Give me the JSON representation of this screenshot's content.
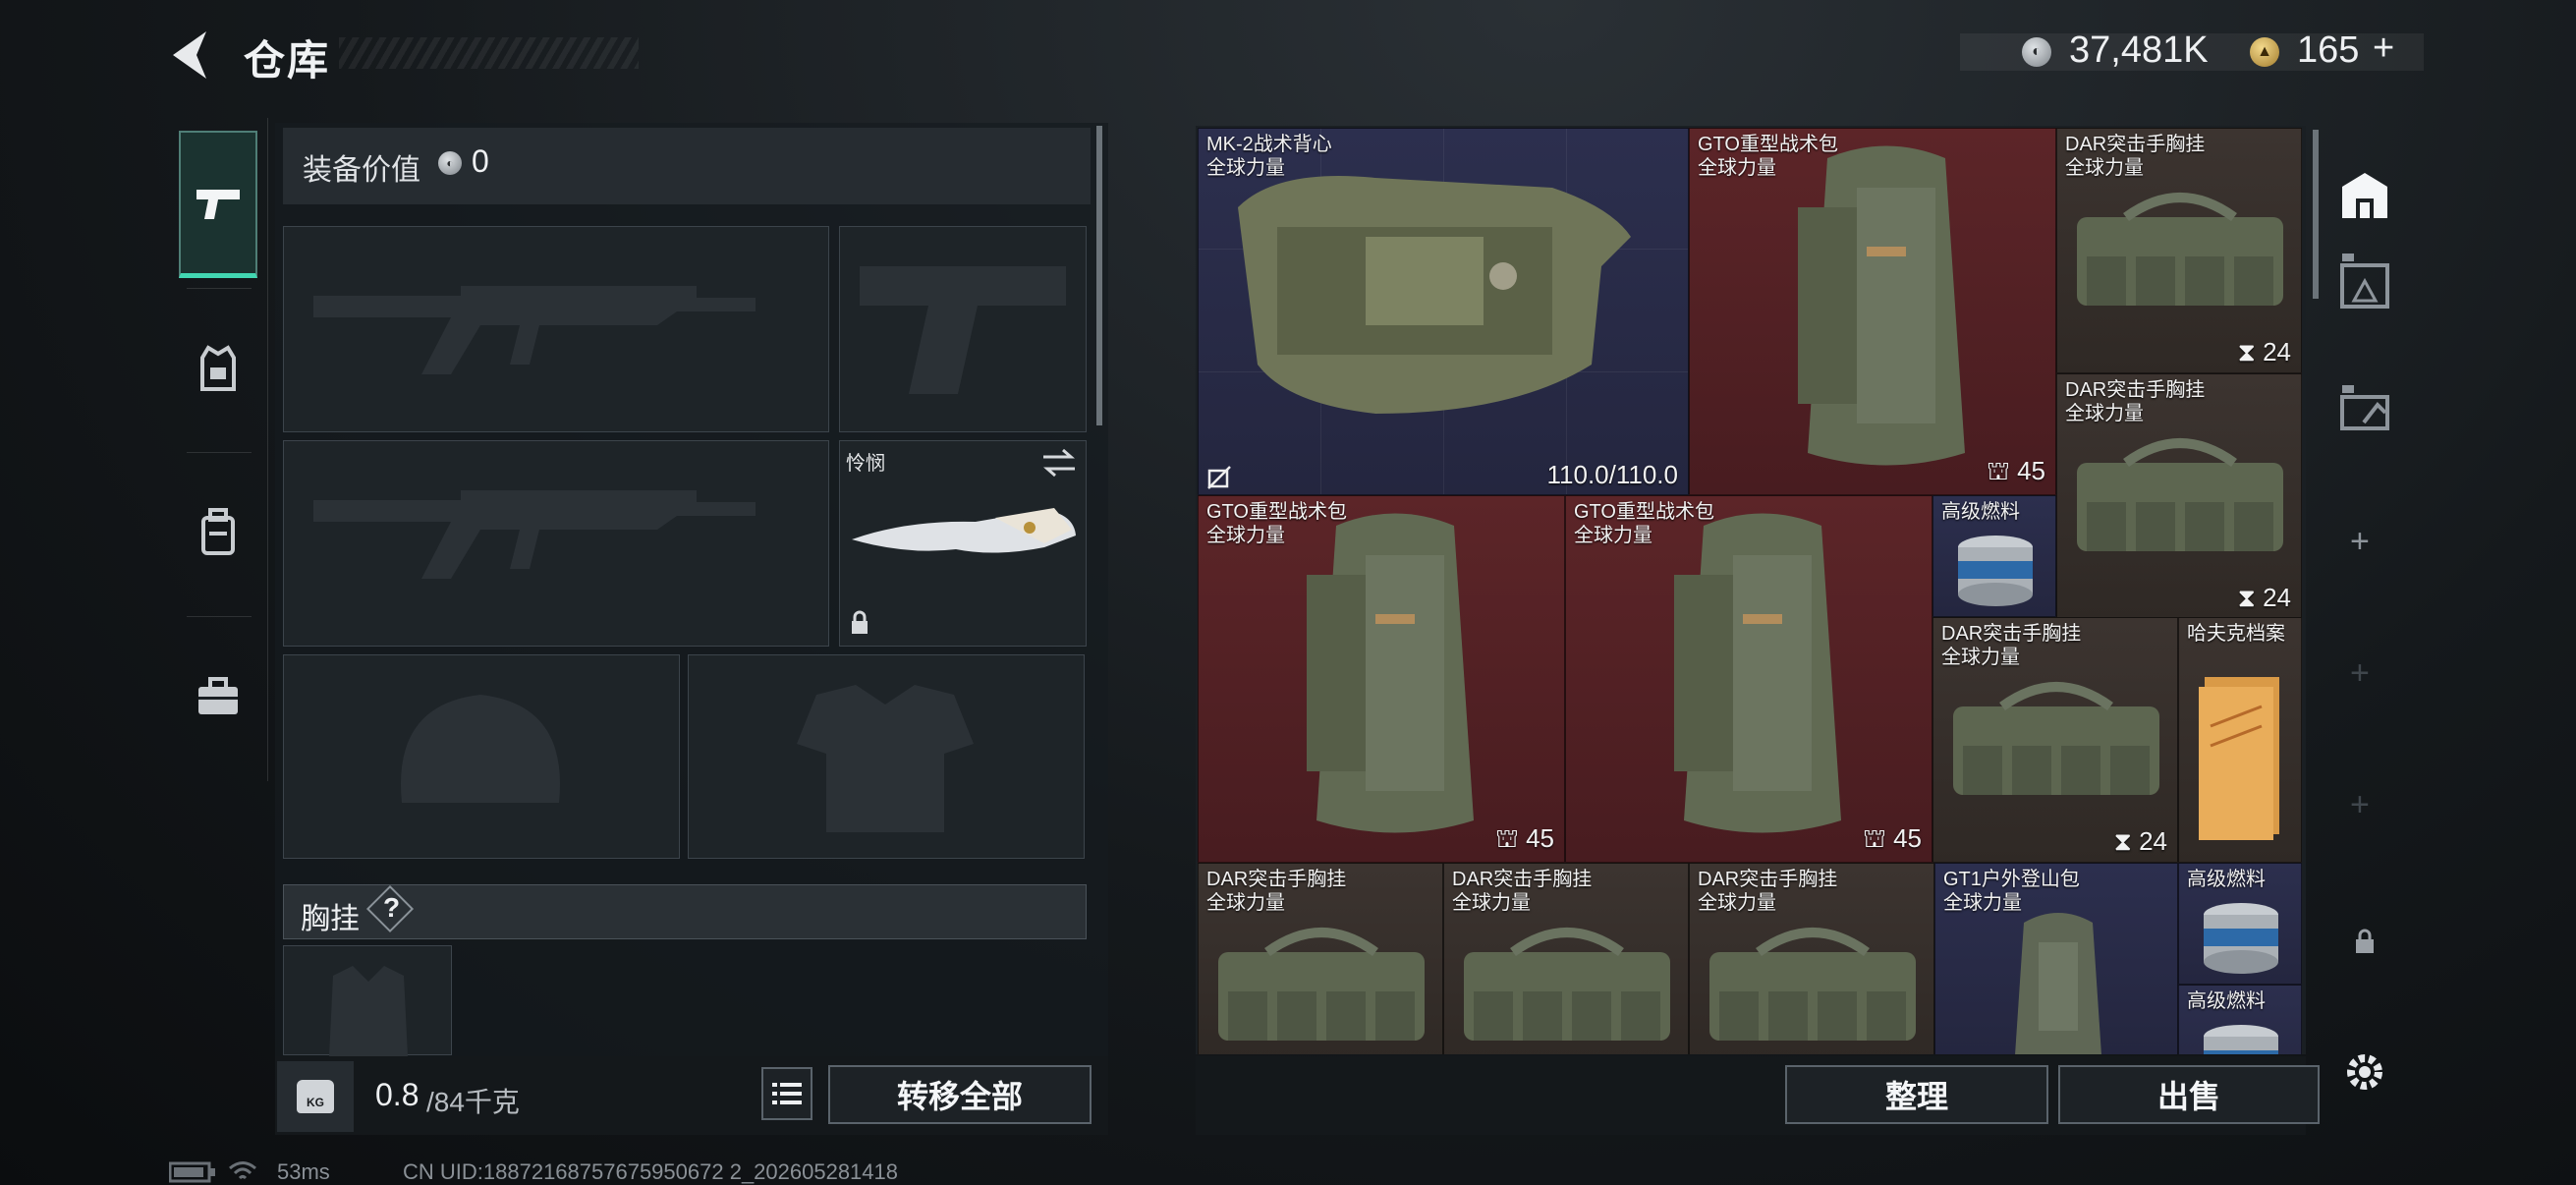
{
  "header": {
    "title": "仓库",
    "currency_silver": "37,481K",
    "currency_gold": "165",
    "add_label": "+"
  },
  "loadout": {
    "value_label": "装备价值",
    "value": "0",
    "melee_name": "怜悯",
    "section_label": "胸挂",
    "help_label": "?",
    "weight_current": "0.8",
    "weight_max": "/84千克",
    "weight_icon_label": "KG",
    "transfer_all": "转移全部"
  },
  "items": [
    {
      "name": "MK-2战术背心",
      "sub": "全球力量",
      "info": "110.0/110.0",
      "color": "blue"
    },
    {
      "name": "GTO重型战术包",
      "sub": "全球力量",
      "info": "45",
      "color": "red"
    },
    {
      "name": "DAR突击手胸挂",
      "sub": "全球力量",
      "info": "24",
      "color": "brown"
    },
    {
      "name": "DAR突击手胸挂",
      "sub": "全球力量",
      "info": "24",
      "color": "brown"
    },
    {
      "name": "GTO重型战术包",
      "sub": "全球力量",
      "info": "45",
      "color": "red"
    },
    {
      "name": "GTO重型战术包",
      "sub": "全球力量",
      "info": "45",
      "color": "red"
    },
    {
      "name": "高级燃料",
      "sub": "",
      "info": "",
      "color": "blue"
    },
    {
      "name": "DAR突击手胸挂",
      "sub": "全球力量",
      "info": "24",
      "color": "brown"
    },
    {
      "name": "哈夫克档案",
      "sub": "",
      "info": "",
      "color": "brown"
    },
    {
      "name": "DAR突击手胸挂",
      "sub": "全球力量",
      "info": "",
      "color": "brown"
    },
    {
      "name": "DAR突击手胸挂",
      "sub": "全球力量",
      "info": "",
      "color": "brown"
    },
    {
      "name": "DAR突击手胸挂",
      "sub": "全球力量",
      "info": "",
      "color": "brown"
    },
    {
      "name": "GT1户外登山包",
      "sub": "全球力量",
      "info": "",
      "color": "blue"
    },
    {
      "name": "高级燃料",
      "sub": "",
      "info": "",
      "color": "blue"
    },
    {
      "name": "高级燃料",
      "sub": "",
      "info": "",
      "color": "blue"
    }
  ],
  "actions": {
    "sort": "整理",
    "sell": "出售"
  },
  "status": {
    "ping": "53ms",
    "uid": "CN UID:18872168757675950672 2_202605281418"
  },
  "colors": {
    "accent": "#42d7b2",
    "red_rarity": "#5c2528",
    "blue_rarity": "#2c2f4e",
    "brown_rarity": "#3c3430"
  }
}
